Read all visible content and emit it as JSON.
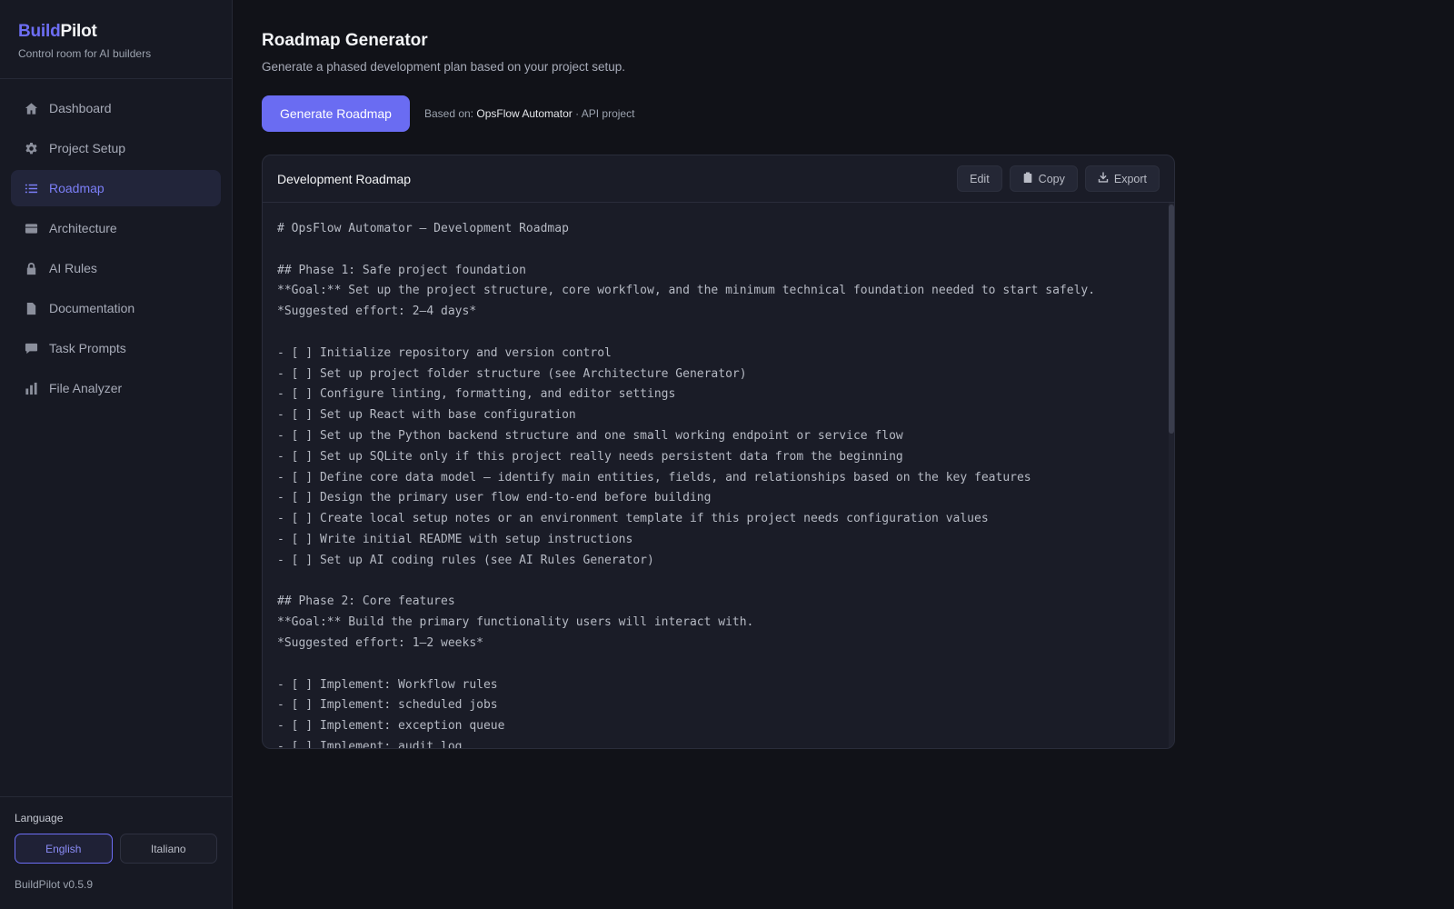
{
  "brand": {
    "part1": "Build",
    "part2": "Pilot",
    "tagline": "Control room for AI builders"
  },
  "nav": [
    {
      "label": "Dashboard",
      "icon": "home-icon"
    },
    {
      "label": "Project Setup",
      "icon": "gear-icon"
    },
    {
      "label": "Roadmap",
      "icon": "list-icon",
      "active": true
    },
    {
      "label": "Architecture",
      "icon": "layers-icon"
    },
    {
      "label": "AI Rules",
      "icon": "lock-icon"
    },
    {
      "label": "Documentation",
      "icon": "document-icon"
    },
    {
      "label": "Task Prompts",
      "icon": "chat-bubble-icon"
    },
    {
      "label": "File Analyzer",
      "icon": "bar-chart-icon"
    }
  ],
  "language": {
    "label": "Language",
    "english": "English",
    "italiano": "Italiano",
    "selected": "English"
  },
  "version": "BuildPilot v0.5.9",
  "page": {
    "title": "Roadmap Generator",
    "subtitle": "Generate a phased development plan based on your project setup.",
    "generate_label": "Generate Roadmap",
    "based_prefix": "Based on:",
    "project_name": "OpsFlow Automator",
    "project_type": "· API project"
  },
  "card": {
    "title": "Development Roadmap",
    "edit_label": "Edit",
    "copy_label": "Copy",
    "export_label": "Export",
    "content": "# OpsFlow Automator — Development Roadmap\n\n## Phase 1: Safe project foundation\n**Goal:** Set up the project structure, core workflow, and the minimum technical foundation needed to start safely.\n*Suggested effort: 2–4 days*\n\n- [ ] Initialize repository and version control\n- [ ] Set up project folder structure (see Architecture Generator)\n- [ ] Configure linting, formatting, and editor settings\n- [ ] Set up React with base configuration\n- [ ] Set up the Python backend structure and one small working endpoint or service flow\n- [ ] Set up SQLite only if this project really needs persistent data from the beginning\n- [ ] Define core data model — identify main entities, fields, and relationships based on the key features\n- [ ] Design the primary user flow end-to-end before building\n- [ ] Create local setup notes or an environment template if this project needs configuration values\n- [ ] Write initial README with setup instructions\n- [ ] Set up AI coding rules (see AI Rules Generator)\n\n## Phase 2: Core features\n**Goal:** Build the primary functionality users will interact with.\n*Suggested effort: 1–2 weeks*\n\n- [ ] Implement: Workflow rules\n- [ ] Implement: scheduled jobs\n- [ ] Implement: exception queue\n- [ ] Implement: audit log"
  },
  "colors": {
    "accent": "#6a6cf2",
    "background": "#111218",
    "sidebar": "#171923"
  }
}
